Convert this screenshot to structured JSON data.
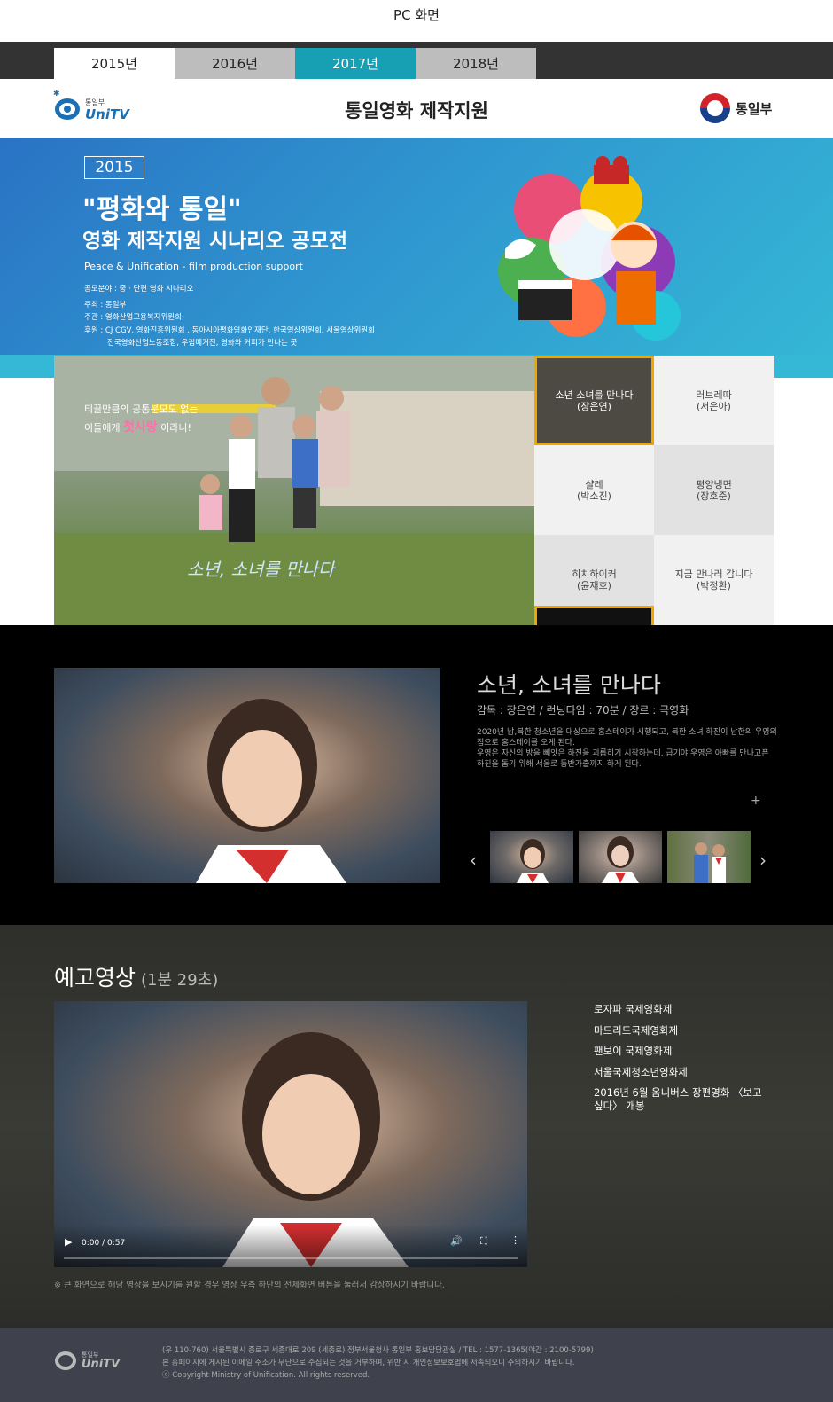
{
  "caption": "PC 화면",
  "tabs": [
    {
      "label": "2015년"
    },
    {
      "label": "2016년"
    },
    {
      "label": "2017년"
    },
    {
      "label": "2018년"
    }
  ],
  "header": {
    "logo_small": "통일부",
    "logo_name": "UniTV",
    "title": "통일영화 제작지원",
    "ministry_label": "통일부"
  },
  "hero": {
    "year": "2015",
    "title1": "\"평화와 통일\"",
    "title2": "영화 제작지원 시나리오 공모전",
    "subtitle": "Peace & Unification - film production support",
    "info": [
      "공모분야 : 중 · 단편 영화 시나리오",
      "주최 : 통일부",
      "주관 : 영화산업고용복지위원회",
      "후원 : CJ CGV, 영화진흥위원회 , 동아시아평화영화인재단, 한국영상위원회, 서울영상위원회",
      "전국영화산업노동조합, 우림메거진, 영화와 커피가 만나는 곳"
    ]
  },
  "feature": {
    "text1": "티끌만큼의 공통분모도 없는",
    "text2_pre": "이들에게",
    "text2_hl": "첫사랑",
    "text2_post": "이라니!",
    "overlay_title": "소년, 소녀를 만나다"
  },
  "films": [
    {
      "title": "소년 소녀를 만나다",
      "director": "(장은연)"
    },
    {
      "title": "러브레따",
      "director": "(서은아)"
    },
    {
      "title": "샬레",
      "director": "(박소진)"
    },
    {
      "title": "평양냉면",
      "director": "(장호준)"
    },
    {
      "title": "히치하이커",
      "director": "(윤재호)"
    },
    {
      "title": "지금 만나러 갑니다",
      "director": "(박정환)"
    }
  ],
  "details": {
    "name": "소년, 소녀를 만나다",
    "meta": "감독 : 장은연 / 런닝타임 : 70분 / 장르 : 극영화",
    "desc1": "2020년 남,북한 청소년을 대상으로 홈스테이가 시행되고, 북한 소녀 하진이 남한의 우영의 집으로 홈스테이를 오게 된다.",
    "desc2": "우영은 자신의 방을 빼앗은 하진을 괴롭히기 시작하는데, 급기야 우영은 아빠를 만나고픈 하진을 돕기 위해 서울로 동반가출까지 하게 된다.",
    "more": "+",
    "prev": "‹",
    "next": "›"
  },
  "trailer": {
    "heading": "예고영상",
    "duration": "(1분 29초)",
    "time": "0:00 / 0:57",
    "notice": "※ 큰 화면으로 해당 영상을 보시기를 원할 경우 영상 우측 하단의 전체화면 버튼을 눌러서 감상하시기 바랍니다.",
    "festivals": [
      "로자파 국제영화제",
      "마드리드국제영화제",
      "팬보이 국제영화제",
      "서울국제청소년영화제",
      "2016년 6월 옴니버스 장편영화 〈보고싶다〉 개봉"
    ]
  },
  "footer": {
    "logo_small": "통일부",
    "logo_name": "UniTV",
    "line1": "(우 110-760) 서울특별시 종로구 세종대로 209 (세종로) 정부서울청사 통일부 홍보담당관실 / TEL : 1577-1365(야간 : 2100-5799)",
    "line2": "본 홈페이지에 게시된 이메일 주소가 무단으로 수집되는 것을 거부하며, 위반 시 개인정보보호법에 저촉되오니 주의하시기 바랍니다.",
    "line3": "ⓒ Copyright Ministry of Unification. All rights reserved."
  },
  "colors": {
    "accent_teal": "#17a0b4",
    "active_border": "#f0a500",
    "brand_blue": "#1b6fb4"
  }
}
